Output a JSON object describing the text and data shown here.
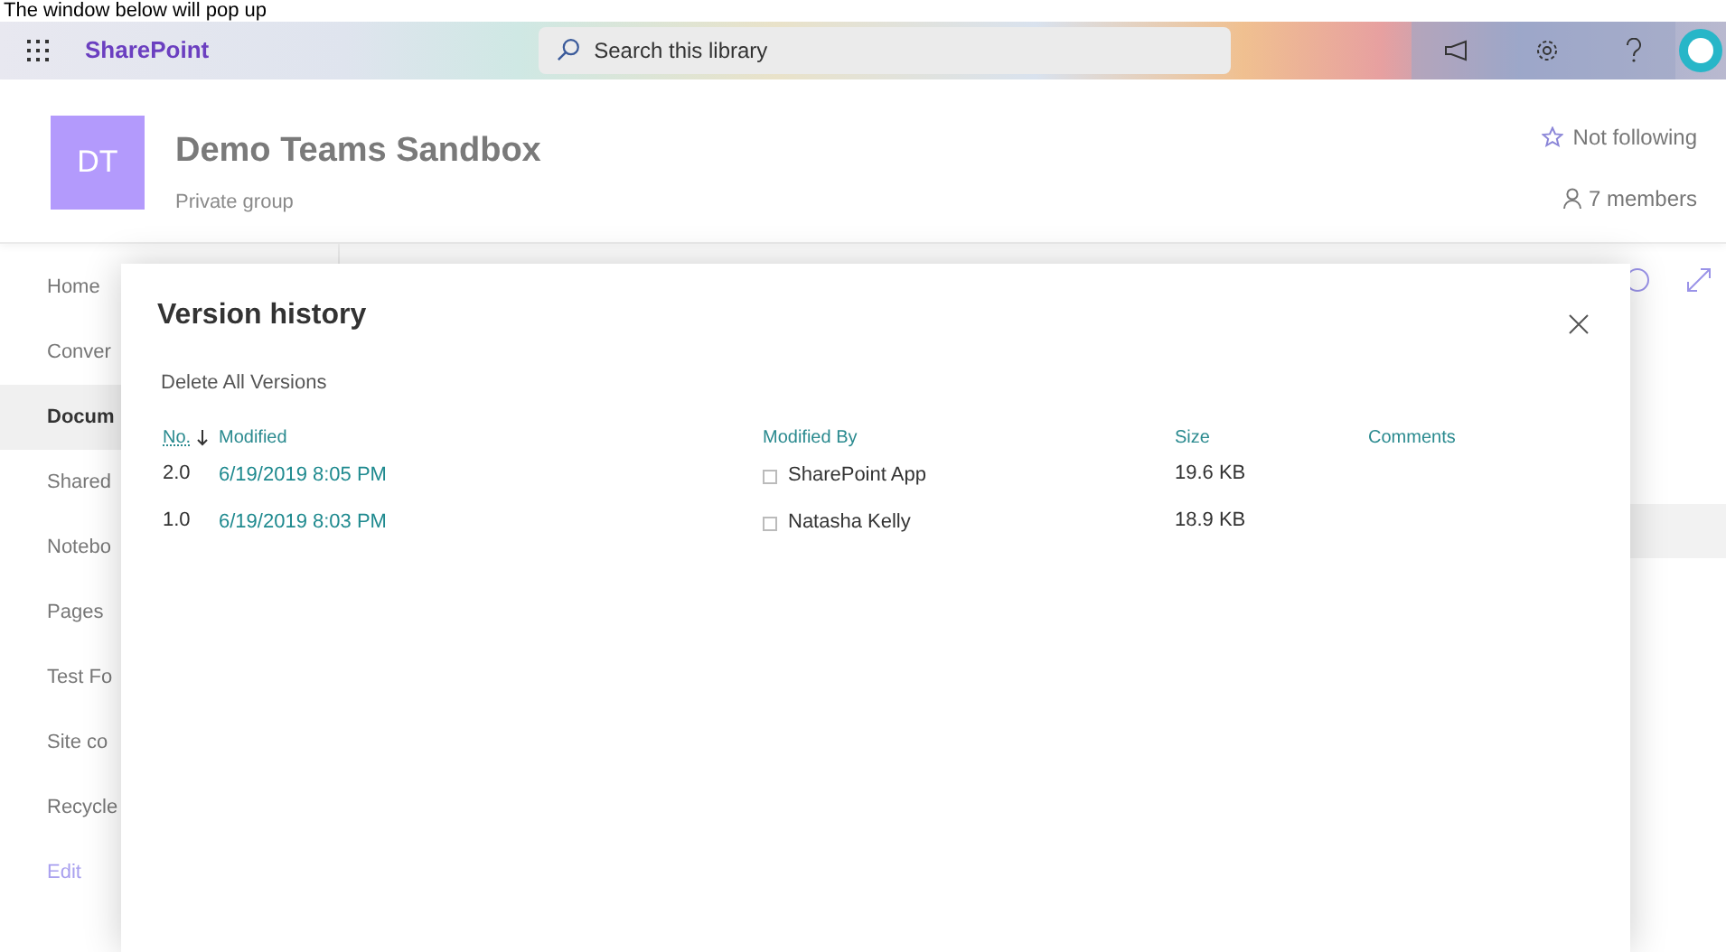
{
  "caption": "The window below will pop up",
  "suite_bar": {
    "app": "SharePoint",
    "search": {
      "placeholder": "Search this library"
    }
  },
  "site": {
    "initials": "DT",
    "title": "Demo Teams Sandbox",
    "subtitle": "Private group",
    "follow": "Not following",
    "members": "7 members"
  },
  "nav": [
    {
      "label": "Home",
      "selected": false,
      "kind": "item"
    },
    {
      "label": "Conver",
      "selected": false,
      "kind": "item"
    },
    {
      "label": "Docum",
      "selected": true,
      "kind": "item"
    },
    {
      "label": "Shared",
      "selected": false,
      "kind": "item"
    },
    {
      "label": "Notebo",
      "selected": false,
      "kind": "item"
    },
    {
      "label": "Pages",
      "selected": false,
      "kind": "item"
    },
    {
      "label": "Test Fo",
      "selected": false,
      "kind": "item"
    },
    {
      "label": "Site co",
      "selected": false,
      "kind": "item"
    },
    {
      "label": "Recycle",
      "selected": false,
      "kind": "item"
    },
    {
      "label": "Edit",
      "selected": false,
      "kind": "link"
    }
  ],
  "dialog": {
    "title": "Version history",
    "action": "Delete All Versions",
    "columns": [
      {
        "label": "No.",
        "sorted": true
      },
      {
        "label": "Modified",
        "sorted": false
      },
      {
        "label": "Modified By",
        "sorted": false
      },
      {
        "label": "Size",
        "sorted": false
      },
      {
        "label": "Comments",
        "sorted": false
      }
    ],
    "rows": [
      {
        "no": "2.0",
        "modified": "6/19/2019 8:05 PM",
        "by": "SharePoint App",
        "size": "19.6 KB"
      },
      {
        "no": "1.0",
        "modified": "6/19/2019 8:03 PM",
        "by": "Natasha Kelly",
        "size": "18.9 KB"
      }
    ]
  }
}
